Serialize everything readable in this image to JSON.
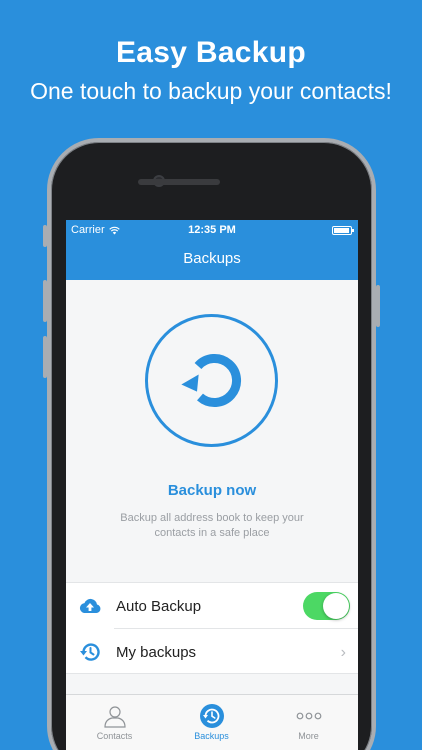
{
  "promo": {
    "headline": "Easy Backup",
    "subhead": "One touch to backup your contacts!"
  },
  "status_bar": {
    "carrier": "Carrier",
    "time": "12:35 PM"
  },
  "nav": {
    "title": "Backups"
  },
  "backup": {
    "label": "Backup now",
    "description": "Backup all address book to keep your contacts in a safe place"
  },
  "settings": {
    "auto_backup_label": "Auto Backup",
    "auto_backup_enabled": true,
    "my_backups_label": "My backups"
  },
  "tabs": [
    {
      "label": "Contacts",
      "icon": "person-icon",
      "selected": false
    },
    {
      "label": "Backups",
      "icon": "clock-icon",
      "selected": true
    },
    {
      "label": "More",
      "icon": "more-dots-icon",
      "selected": false
    }
  ],
  "colors": {
    "brand_blue": "#2a8fdc",
    "toggle_on": "#4cd864"
  }
}
